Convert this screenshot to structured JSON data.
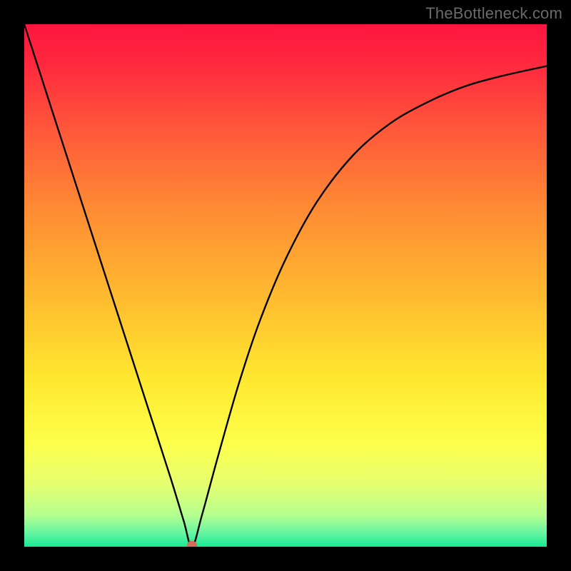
{
  "watermark": "TheBottleneck.com",
  "gradient_stops": [
    {
      "offset": 0.0,
      "color": "#ff1540"
    },
    {
      "offset": 0.08,
      "color": "#ff2a3e"
    },
    {
      "offset": 0.2,
      "color": "#ff573a"
    },
    {
      "offset": 0.35,
      "color": "#ff8a34"
    },
    {
      "offset": 0.52,
      "color": "#ffba2f"
    },
    {
      "offset": 0.68,
      "color": "#ffe82f"
    },
    {
      "offset": 0.8,
      "color": "#fdff4a"
    },
    {
      "offset": 0.88,
      "color": "#e6ff70"
    },
    {
      "offset": 0.94,
      "color": "#b4ff8f"
    },
    {
      "offset": 0.975,
      "color": "#63f5a3"
    },
    {
      "offset": 1.0,
      "color": "#17e892"
    }
  ],
  "marker": {
    "x_frac": 0.321,
    "y_frac": 0.997,
    "color": "#d46a5a",
    "rx": 7,
    "ry": 6
  },
  "chart_data": {
    "type": "line",
    "title": "",
    "xlabel": "",
    "ylabel": "",
    "x_range": [
      0,
      1
    ],
    "y_range": [
      0,
      1
    ],
    "series": [
      {
        "name": "bottleneck-curve",
        "x": [
          0.0,
          0.04,
          0.08,
          0.12,
          0.16,
          0.2,
          0.24,
          0.28,
          0.305,
          0.321,
          0.34,
          0.37,
          0.41,
          0.45,
          0.5,
          0.56,
          0.63,
          0.7,
          0.77,
          0.84,
          0.91,
          1.0
        ],
        "y": [
          1.0,
          0.876,
          0.752,
          0.628,
          0.504,
          0.38,
          0.256,
          0.132,
          0.05,
          0.0,
          0.06,
          0.17,
          0.31,
          0.43,
          0.55,
          0.66,
          0.75,
          0.81,
          0.85,
          0.88,
          0.9,
          0.92
        ]
      }
    ],
    "note": "x and y are normalized fractions of the plot area (0 = left/bottom, 1 = right/top). The curve descends steeply and linearly from the top-left to the marker at x≈0.321, then rises with a decelerating (concave-down) sweep toward the upper-right. Values are estimated from the image; no axis tick labels are visible."
  }
}
